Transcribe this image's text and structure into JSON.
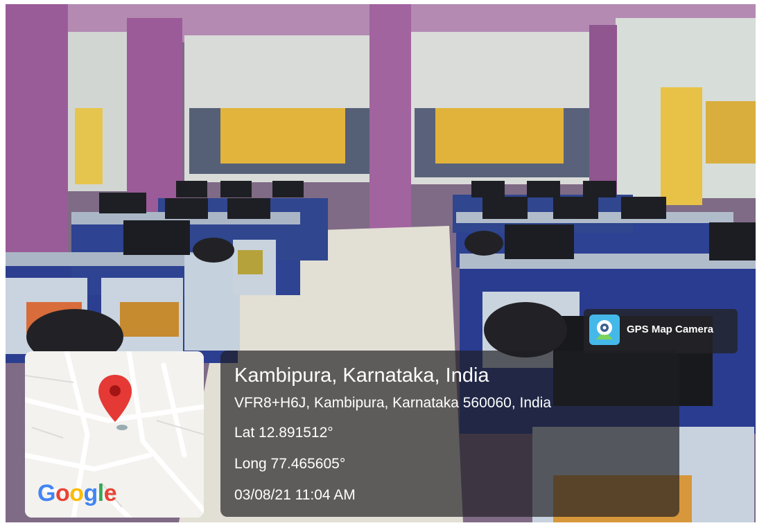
{
  "photo": {
    "subject": "computer lab scene"
  },
  "badge": {
    "label": "GPS Map Camera",
    "icon": "camera-pin-icon"
  },
  "map": {
    "logo_parts": [
      "G",
      "o",
      "o",
      "g",
      "l",
      "e"
    ],
    "logo_colors": [
      "#4285F4",
      "#EA4335",
      "#FBBC05",
      "#4285F4",
      "#34A853",
      "#EA4335"
    ],
    "pin_color": "#e53935"
  },
  "location": {
    "place": "Kambipura, Karnataka, India",
    "address": "VFR8+H6J, Kambipura, Karnataka 560060, India",
    "lat": "Lat 12.891512°",
    "long": "Long 77.465605°",
    "datetime": "03/08/21 11:04 AM"
  }
}
